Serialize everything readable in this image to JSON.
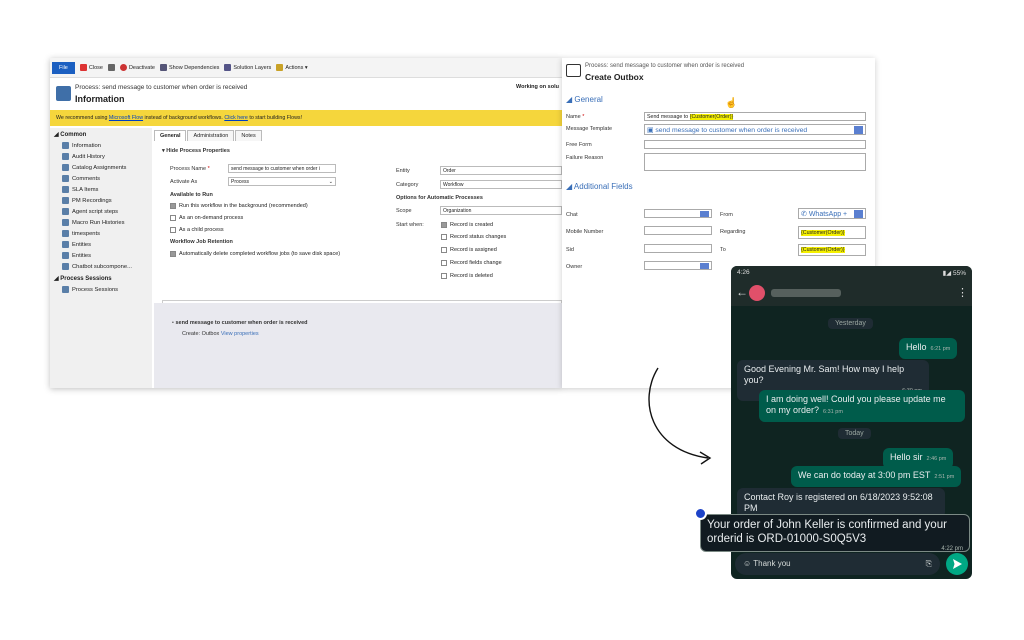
{
  "ribbon": {
    "file": "File",
    "close": "Close",
    "deactivate": "Deactivate",
    "show_dependencies": "Show Dependencies",
    "solution_layers": "Solution Layers",
    "actions": "Actions ▾"
  },
  "header": {
    "process": "Process: send message to customer when order is received",
    "title": "Information",
    "working": "Working on solu"
  },
  "banner": {
    "text_before": "We recommend using ",
    "link1": "Microsoft Flow",
    "text_mid": " instead of background workflows. ",
    "link2": "Click here",
    "text_after": " to start building Flows!"
  },
  "sidebar": {
    "common_label": "◢ Common",
    "items": [
      "Information",
      "Audit History",
      "Catalog Assignments",
      "Comments",
      "SLA Items",
      "PM Recordings",
      "Agent script steps",
      "Macro Run Histories",
      "timespents",
      "Entities",
      "Entities",
      "Chatbot subcompone..."
    ],
    "sessions_label": "◢ Process Sessions",
    "sessions_item": "Process Sessions"
  },
  "tabs": [
    "General",
    "Administration",
    "Notes"
  ],
  "form": {
    "hide_props": "Hide Process Properties",
    "process_name_label": "Process Name",
    "process_name_value": "send message to customer when order i",
    "activate_as_label": "Activate As",
    "activate_as_value": "Process",
    "available_to_run": "Available to Run",
    "opt_background": "Run this workflow in the background (recommended)",
    "opt_ondemand": "As an on-demand process",
    "opt_child": "As a child process",
    "retention": "Workflow Job Retention",
    "opt_delete": "Automatically delete completed workflow jobs (to save disk space)",
    "entity_label": "Entity",
    "entity_value": "Order",
    "category_label": "Category",
    "category_value": "Workflow",
    "auto_opts": "Options for Automatic Processes",
    "scope_label": "Scope",
    "scope_value": "Organization",
    "start_when_label": "Start when:",
    "start_opts": [
      "Record is created",
      "Record status changes",
      "Record is assigned",
      "Record fields change",
      "Record is deleted"
    ],
    "step_text": "send message to customer when order is received",
    "step_sub": "Create:  Outbox",
    "view_props": "View properties"
  },
  "outbox": {
    "process": "Process: send message to customer when order is received",
    "title": "Create Outbox",
    "general": "◢ General",
    "name_label": "Name",
    "name_prefix": "Send message to ",
    "name_token": "{Customer(Order)}",
    "template_label": "Message Template",
    "template_value": "send message to customer when order is received",
    "free_form_label": "Free Form",
    "failure_label": "Failure Reason",
    "additional": "◢ Additional Fields",
    "chat_label": "Chat",
    "from_label": "From",
    "from_value": "WhatsApp +",
    "mobile_label": "Mobile Number",
    "regarding_label": "Regarding",
    "regarding_value": "{Customer(Order)}",
    "sid_label": "Sid",
    "to_label": "To",
    "to_value": "{Customer(Order)}",
    "owner_label": "Owner"
  },
  "chat": {
    "time": "4:26",
    "battery": "55%",
    "day1": "Yesterday",
    "m1": "Hello",
    "m1_time": "6:21 pm",
    "m2": "Good Evening Mr. Sam! How may I help you?",
    "m2_time": "6:30 pm",
    "m3": "I am doing well! Could you please update me on my order?",
    "m3_time": "6:31 pm",
    "day2": "Today",
    "m4": "Hello sir",
    "m4_time": "2:46 pm",
    "m5": "We can do today at 3:00 pm EST",
    "m5_time": "2:51 pm",
    "m6": "Contact Roy is registered on 6/18/2023 9:52:08 PM",
    "m7": "Your order of John Keller is confirmed and your orderid is ORD-01000-S0Q5V3",
    "m7_time": "4:22 pm",
    "input": "Thank you"
  },
  "colors": {
    "whatsapp_out": "#005c4b",
    "send": "#00a884",
    "banner": "#f5d63c",
    "link": "#3a6fb8"
  }
}
